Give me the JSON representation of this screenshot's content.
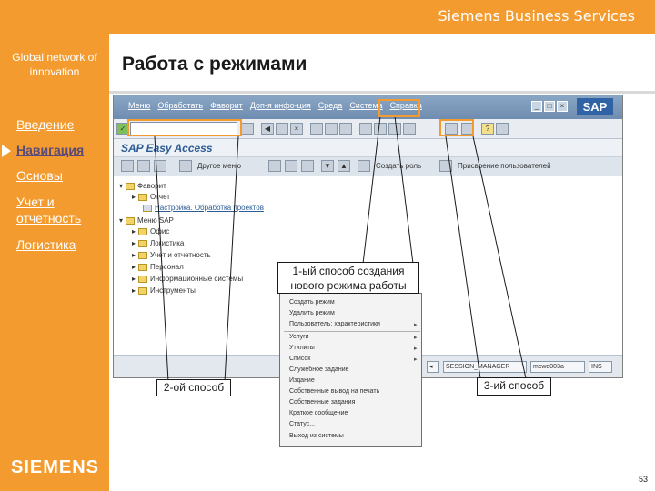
{
  "header": {
    "brand": "Siemens Business Services",
    "tagline": "Global network of innovation",
    "title": "Работа с режимами"
  },
  "sidebar": {
    "items": [
      {
        "label": "Введение",
        "active": false
      },
      {
        "label": "Навигация",
        "active": true
      },
      {
        "label": "Основы",
        "active": false
      },
      {
        "label": "Учет и отчетность",
        "active": false
      },
      {
        "label": "Логистика",
        "active": false
      }
    ]
  },
  "footer": {
    "logo": "SIEMENS",
    "page_number": "53"
  },
  "sap": {
    "menu_items": [
      "Меню",
      "Обработать",
      "Фаворит",
      "Доп-я инфо-ция",
      "Среда",
      "Система",
      "Справка"
    ],
    "logo": "SAP",
    "screen_title": "SAP Easy Access",
    "app_toolbar": {
      "other_menu": "Другое меню",
      "create_role": "Создать роль",
      "assign_users": "Присвоение пользователей"
    },
    "tree": [
      {
        "label": "Фаворит",
        "link": false
      },
      {
        "label": "Отчет",
        "link": false
      },
      {
        "label": "Настройка. Обработка проектов",
        "link": true
      },
      {
        "label": "Меню SAP",
        "link": false
      },
      {
        "label": "Офис",
        "link": false
      },
      {
        "label": "Логистика",
        "link": false
      },
      {
        "label": "Учет и отчетность",
        "link": false
      },
      {
        "label": "Персонал",
        "link": false
      },
      {
        "label": "Информационные системы",
        "link": false
      },
      {
        "label": "Инструменты",
        "link": false
      }
    ],
    "status": {
      "session": "SESSION_MANAGER",
      "client": "mcwd003a",
      "mode": "INS"
    }
  },
  "popup": {
    "items": [
      {
        "label": "Создать режим",
        "sub": false
      },
      {
        "label": "Удалить режим",
        "sub": false
      },
      {
        "label": "Пользователь: характеристики",
        "sub": true
      },
      {
        "label": "Услуги",
        "sub": true
      },
      {
        "label": "Утилиты",
        "sub": true
      },
      {
        "label": "Список",
        "sub": true
      },
      {
        "label": "Служебное задание",
        "sub": false
      },
      {
        "label": "Издание",
        "sub": false
      },
      {
        "label": "Собственные вывод на печать",
        "sub": false
      },
      {
        "label": "Собственные задания",
        "sub": false
      },
      {
        "label": "Краткое сообщение",
        "sub": false
      },
      {
        "label": "Статус...",
        "sub": false
      },
      {
        "label": "Выход из системы",
        "sub": false
      }
    ]
  },
  "callouts": {
    "first": "1-ый способ создания нового режима работы",
    "second": "2-ой способ",
    "third": "3-ий способ"
  },
  "colors": {
    "frame_orange": "#f39b2f",
    "sap_blue": "#2c5c94",
    "highlight": "#f39b2f"
  }
}
